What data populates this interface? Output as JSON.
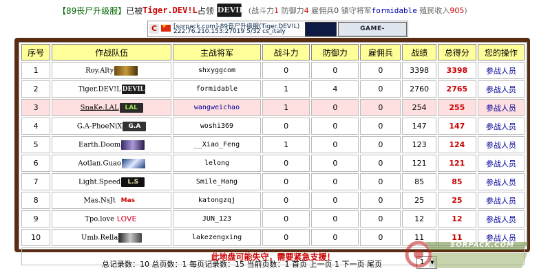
{
  "header": {
    "title": "【89丧尸升级服】",
    "captured_prefix": "已被",
    "captured_team": "Tiger.DEV!L",
    "captured_suffix": "占领",
    "logo_text": "DEVIL",
    "stats_attack_label": "(战斗力",
    "stats_attack_value": "1",
    "stats_defense_label": " 防御力",
    "stats_defense_value": "4",
    "stats_merc_label": " 雇佣兵",
    "stats_merc_value": "0",
    "stats_general_label": " 镇守将军",
    "stats_general_value": "formidable",
    "stats_income_label": " 殖民收入",
    "stats_income_value": "905",
    "stats_close": ")"
  },
  "banner": {
    "line1": "[sorpack.com]-89丧尸升级服(Tiger.DEV!L)",
    "line2": "222.76.210.153:27019    5/32      cs_italy",
    "monitor": "GAME-MONITOR.com"
  },
  "table": {
    "headers": [
      "序号",
      "作战队伍",
      "主战将军",
      "战斗力",
      "防御力",
      "雇佣兵",
      "战绩",
      "总得分",
      "您的操作"
    ],
    "rows": [
      {
        "no": "1",
        "team": "Roy.Alty",
        "logo": "",
        "commander": "shxyggcom",
        "attack": "0",
        "defense": "0",
        "merc": "0",
        "record": "3398",
        "score": "3398",
        "action": "参战人员"
      },
      {
        "no": "2",
        "team": "Tiger.DEV!L",
        "logo": "DEVIL",
        "commander": "formidable",
        "attack": "1",
        "defense": "4",
        "merc": "0",
        "record": "2760",
        "score": "2765",
        "action": "参战人员"
      },
      {
        "no": "3",
        "team": "SnaKe.LAL",
        "logo": "LAL",
        "commander": "wangweichao",
        "attack": "1",
        "defense": "0",
        "merc": "0",
        "record": "254",
        "score": "255",
        "action": "参战人员"
      },
      {
        "no": "4",
        "team": "G.A-PhoeNiX",
        "logo": "G.A",
        "commander": "woshi369",
        "attack": "0",
        "defense": "0",
        "merc": "0",
        "record": "147",
        "score": "147",
        "action": "参战人员"
      },
      {
        "no": "5",
        "team": "Earth.Doom",
        "logo": "",
        "commander": "__Xiao_Feng",
        "attack": "1",
        "defense": "0",
        "merc": "0",
        "record": "123",
        "score": "124",
        "action": "参战人员"
      },
      {
        "no": "6",
        "team": "Aotlan.Guao",
        "logo": "",
        "commander": "lelong",
        "attack": "0",
        "defense": "0",
        "merc": "0",
        "record": "121",
        "score": "121",
        "action": "参战人员"
      },
      {
        "no": "7",
        "team": "Light.Speed",
        "logo": "L.S",
        "commander": "Smile_Hang",
        "attack": "0",
        "defense": "0",
        "merc": "0",
        "record": "85",
        "score": "85",
        "action": "参战人员"
      },
      {
        "no": "8",
        "team": "Mas.NsJt",
        "logo": "Mas",
        "commander": "katongzqj",
        "attack": "0",
        "defense": "0",
        "merc": "0",
        "record": "25",
        "score": "25",
        "action": "参战人员"
      },
      {
        "no": "9",
        "team": "Tpo.love",
        "logo": "LOVE",
        "commander": "JUN_123",
        "attack": "0",
        "defense": "0",
        "merc": "0",
        "record": "12",
        "score": "12",
        "action": "参战人员"
      },
      {
        "no": "10",
        "team": "Umb.Rella",
        "logo": "",
        "commander": "lakezengxing",
        "attack": "0",
        "defense": "0",
        "merc": "0",
        "record": "11",
        "score": "11",
        "action": "参战人员"
      }
    ],
    "warning": "此地盘可能失守，需要紧急支援！"
  },
  "footer": {
    "total_label": "总记录数：",
    "total_value": "10",
    "pages_label": "总页数：",
    "pages_value": "1",
    "per_page_label": "每页记录数：",
    "per_page_value": "15",
    "current_label": "当前页数：",
    "current_value": "1",
    "first": "首页",
    "prev": "上一页",
    "page_num": "1",
    "next": "下一页",
    "last": "尾页",
    "select_value": "1"
  },
  "watermark": {
    "text": "SORPACK.COM"
  },
  "colors": {
    "frame": "#5a2d12",
    "header_cell": "#ffff99",
    "highlight_row": "#ffe0e0",
    "score_red": "#cc0000",
    "link_blue": "#000099"
  }
}
